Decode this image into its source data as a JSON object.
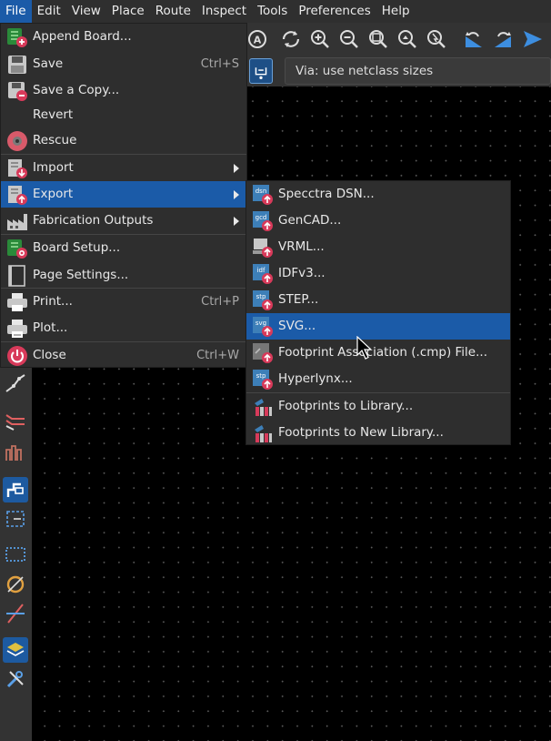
{
  "menubar": {
    "items": [
      {
        "label": "File",
        "active": true
      },
      {
        "label": "Edit"
      },
      {
        "label": "View"
      },
      {
        "label": "Place"
      },
      {
        "label": "Route"
      },
      {
        "label": "Inspect"
      },
      {
        "label": "Tools"
      },
      {
        "label": "Preferences"
      },
      {
        "label": "Help"
      }
    ]
  },
  "aux_toolbar": {
    "via_label": "Via: use netclass sizes"
  },
  "file_menu": {
    "items": [
      {
        "label": "Append Board...",
        "shortcut": "",
        "icon": "append-board-icon"
      },
      {
        "label": "Save",
        "shortcut": "Ctrl+S",
        "icon": "save-icon"
      },
      {
        "label": "Save a Copy...",
        "shortcut": "",
        "icon": "save-copy-icon"
      },
      {
        "label": "Revert",
        "shortcut": "",
        "icon": ""
      },
      {
        "label": "Rescue",
        "shortcut": "",
        "icon": "rescue-icon"
      },
      {
        "label": "Import",
        "shortcut": "",
        "icon": "import-icon",
        "submenu": true
      },
      {
        "label": "Export",
        "shortcut": "",
        "icon": "export-icon",
        "submenu": true,
        "highlighted": true
      },
      {
        "label": "Fabrication Outputs",
        "shortcut": "",
        "icon": "fabrication-icon",
        "submenu": true
      },
      {
        "label": "Board Setup...",
        "shortcut": "",
        "icon": "board-setup-icon"
      },
      {
        "label": "Page Settings...",
        "shortcut": "",
        "icon": "page-settings-icon"
      },
      {
        "label": "Print...",
        "shortcut": "Ctrl+P",
        "icon": "print-icon"
      },
      {
        "label": "Plot...",
        "shortcut": "",
        "icon": "plot-icon"
      },
      {
        "label": "Close",
        "shortcut": "Ctrl+W",
        "icon": "close-icon"
      }
    ]
  },
  "export_menu": {
    "items": [
      {
        "label": "Specctra DSN...",
        "tag": "dsn"
      },
      {
        "label": "GenCAD...",
        "tag": "gcd"
      },
      {
        "label": "VRML...",
        "tag": ""
      },
      {
        "label": "IDFv3...",
        "tag": "idf"
      },
      {
        "label": "STEP...",
        "tag": "stp"
      },
      {
        "label": "SVG...",
        "tag": "svg",
        "highlighted": true
      },
      {
        "label": "Footprint Association (.cmp) File...",
        "tag": ""
      },
      {
        "label": "Hyperlynx...",
        "tag": "stp"
      },
      {
        "label": "Footprints to Library...",
        "tag": ""
      },
      {
        "label": "Footprints to New Library...",
        "tag": ""
      }
    ]
  },
  "colors": {
    "highlight": "#1b5ba8",
    "menu_bg": "#2e2e2e",
    "canvas_bg": "#000000",
    "toolbar_bg": "#333333"
  }
}
